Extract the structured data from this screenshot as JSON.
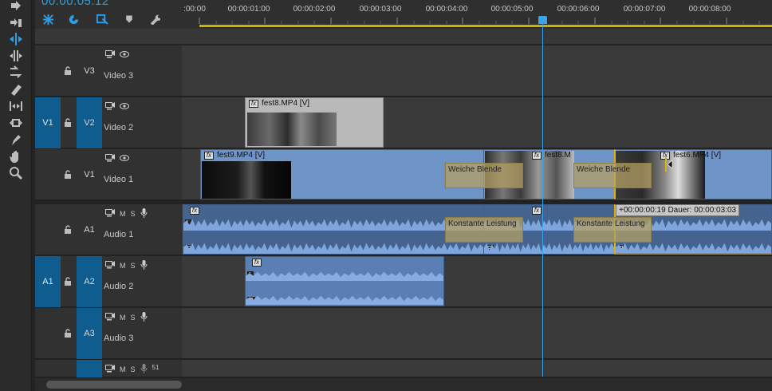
{
  "timecode": "00:00:05:12",
  "ruler_ticks": [
    ":00:00",
    "00:00:01:00",
    "00:00:02:00",
    "00:00:03:00",
    "00:00:04:00",
    "00:00:05:00",
    "00:00:06:00",
    "00:00:07:00",
    "00:00:08:00"
  ],
  "track_controls": {
    "video": [
      "toggle-sync",
      "eye"
    ],
    "audio_labels": {
      "mute": "M",
      "solo": "S"
    },
    "master_label": "51"
  },
  "tracks": {
    "v3": {
      "target": "V3",
      "name": "Video 3"
    },
    "v2": {
      "source": "V1",
      "target": "V2",
      "name": "Video 2"
    },
    "v1": {
      "target": "V1",
      "name": "Video 1"
    },
    "a1": {
      "target": "A1",
      "name": "Audio 1"
    },
    "a2": {
      "source": "A1",
      "target": "A2",
      "name": "Audio 2"
    },
    "a3": {
      "target": "A3",
      "name": "Audio 3"
    }
  },
  "clips": {
    "fest8_top": "fest8.MP4 [V]",
    "fest9": "fest9.MP4 [V]",
    "fest8_mid": "fest8.M",
    "fest6": "fest6.MP4 [V]"
  },
  "transitions": {
    "video_1": "Weiche Blende",
    "video_2": "Weiche Blende",
    "audio_1": "Konstante Leistung",
    "audio_2": "Konstante Leistung"
  },
  "channel_labels": {
    "left": "L",
    "right": "R"
  },
  "tooltip": "+00:00:00:19 Dauer: 00:00:03:03",
  "colors": {
    "accent_blue": "#2d9fe8",
    "track_target": "#0f5c8f",
    "video_clip": "#6f94c8",
    "audio_clip": "#5a7fb5",
    "work_area": "#c8b400"
  }
}
